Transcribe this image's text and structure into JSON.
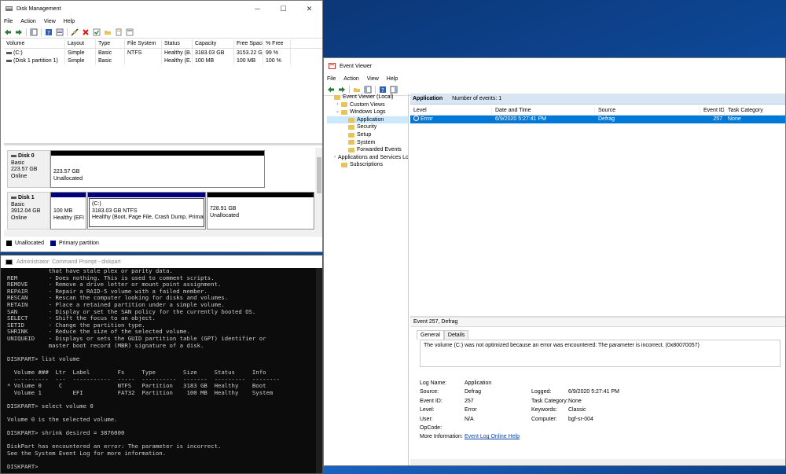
{
  "disk_mgmt": {
    "title": "Disk Management",
    "menu": [
      "File",
      "Action",
      "View",
      "Help"
    ],
    "columns": [
      "Volume",
      "Layout",
      "Type",
      "File System",
      "Status",
      "Capacity",
      "Free Space",
      "% Free"
    ],
    "rows": [
      [
        "(C:)",
        "Simple",
        "Basic",
        "NTFS",
        "Healthy (B...",
        "3183.03 GB",
        "3153.22 GB",
        "99 %"
      ],
      [
        "(Disk 1 partition 1)",
        "Simple",
        "Basic",
        "",
        "Healthy (E...",
        "100 MB",
        "100 MB",
        "100 %"
      ]
    ],
    "disk0": {
      "name": "Disk 0",
      "type": "Basic",
      "size": "223.57 GB",
      "status": "Online",
      "part_size": "223.57 GB",
      "part_status": "Unallocated"
    },
    "disk1": {
      "name": "Disk 1",
      "type": "Basic",
      "size": "3912.04 GB",
      "status": "Online",
      "p1_size": "100 MB",
      "p1_status": "Healthy (EFI S",
      "p2_name": "(C:)",
      "p2_size": "3183.03 GB NTFS",
      "p2_status": "Healthy (Boot, Page File, Crash Dump, Primary Par",
      "p3_size": "728.91 GB",
      "p3_status": "Unallocated"
    },
    "legend": [
      "Unallocated",
      "Primary partition"
    ],
    "colors": {
      "unallocated": "#000000",
      "primary": "#000080"
    }
  },
  "cmd": {
    "title": "Administrator: Command Prompt - diskpart",
    "lines": [
      "            that have stale plex or parity data.",
      "REM         - Does nothing. This is used to comment scripts.",
      "REMOVE      - Remove a drive letter or mount point assignment.",
      "REPAIR      - Repair a RAID-5 volume with a failed member.",
      "RESCAN      - Rescan the computer looking for disks and volumes.",
      "RETAIN      - Place a retained partition under a simple volume.",
      "SAN         - Display or set the SAN policy for the currently booted OS.",
      "SELECT      - Shift the focus to an object.",
      "SETID       - Change the partition type.",
      "SHRINK      - Reduce the size of the selected volume.",
      "UNIQUEID    - Displays or sets the GUID partition table (GPT) identifier or",
      "            master boot record (MBR) signature of a disk.",
      "",
      "DISKPART> list volume",
      "",
      "  Volume ###  Ltr  Label        Fs     Type        Size     Status     Info",
      "  ----------  ---  -----------  -----  ----------  -------  ---------  --------",
      "* Volume 0     C                NTFS   Partition   3183 GB  Healthy    Boot",
      "  Volume 1         EFI          FAT32  Partition    100 MB  Healthy    System",
      "",
      "DISKPART> select volume 0",
      "",
      "Volume 0 is the selected volume.",
      "",
      "DISKPART> shrink desired = 3876000",
      "",
      "DiskPart has encountered an error: The parameter is incorrect.",
      "See the System Event Log for more information.",
      "",
      "DISKPART>"
    ]
  },
  "event_viewer": {
    "title": "Event Viewer",
    "menu": [
      "File",
      "Action",
      "View",
      "Help"
    ],
    "tree": [
      {
        "label": "Event Viewer (Local)",
        "level": 0,
        "arrow": ""
      },
      {
        "label": "Custom Views",
        "level": 1,
        "arrow": "›"
      },
      {
        "label": "Windows Logs",
        "level": 1,
        "arrow": "⌄"
      },
      {
        "label": "Application",
        "level": 2,
        "arrow": ""
      },
      {
        "label": "Security",
        "level": 2,
        "arrow": ""
      },
      {
        "label": "Setup",
        "level": 2,
        "arrow": ""
      },
      {
        "label": "System",
        "level": 2,
        "arrow": ""
      },
      {
        "label": "Forwarded Events",
        "level": 2,
        "arrow": ""
      },
      {
        "label": "Applications and Services Lo",
        "level": 1,
        "arrow": "›"
      },
      {
        "label": "Subscriptions",
        "level": 1,
        "arrow": ""
      }
    ],
    "header_title": "Application",
    "header_count": "Number of events: 1",
    "columns": [
      "Level",
      "Date and Time",
      "Source",
      "Event ID",
      "Task Category"
    ],
    "event": {
      "level": "Error",
      "datetime": "6/9/2020 5:27:41 PM",
      "source": "Defrag",
      "id": "257",
      "category": "None"
    },
    "detail_title": "Event 257, Defrag",
    "tabs": [
      "General",
      "Details"
    ],
    "message": "The volume (C:) was not optimized because an error was encountered: The parameter is incorrect. (0x80070057)",
    "props": {
      "log_name_l": "Log Name:",
      "log_name": "Application",
      "source_l": "Source:",
      "source": "Defrag",
      "logged_l": "Logged:",
      "logged": "6/9/2020 5:27:41 PM",
      "event_id_l": "Event ID:",
      "event_id": "257",
      "task_l": "Task Category:",
      "task": "None",
      "level_l": "Level:",
      "level": "Error",
      "keywords_l": "Keywords:",
      "keywords": "Classic",
      "user_l": "User:",
      "user": "N/A",
      "computer_l": "Computer:",
      "computer": "bgf-sr-004",
      "opcode_l": "OpCode:",
      "opcode": "",
      "more_l": "More Information:",
      "more_link": "Event Log Online Help"
    },
    "colors": {
      "selection": "#0078d7",
      "header": "#d9e5f2"
    }
  }
}
